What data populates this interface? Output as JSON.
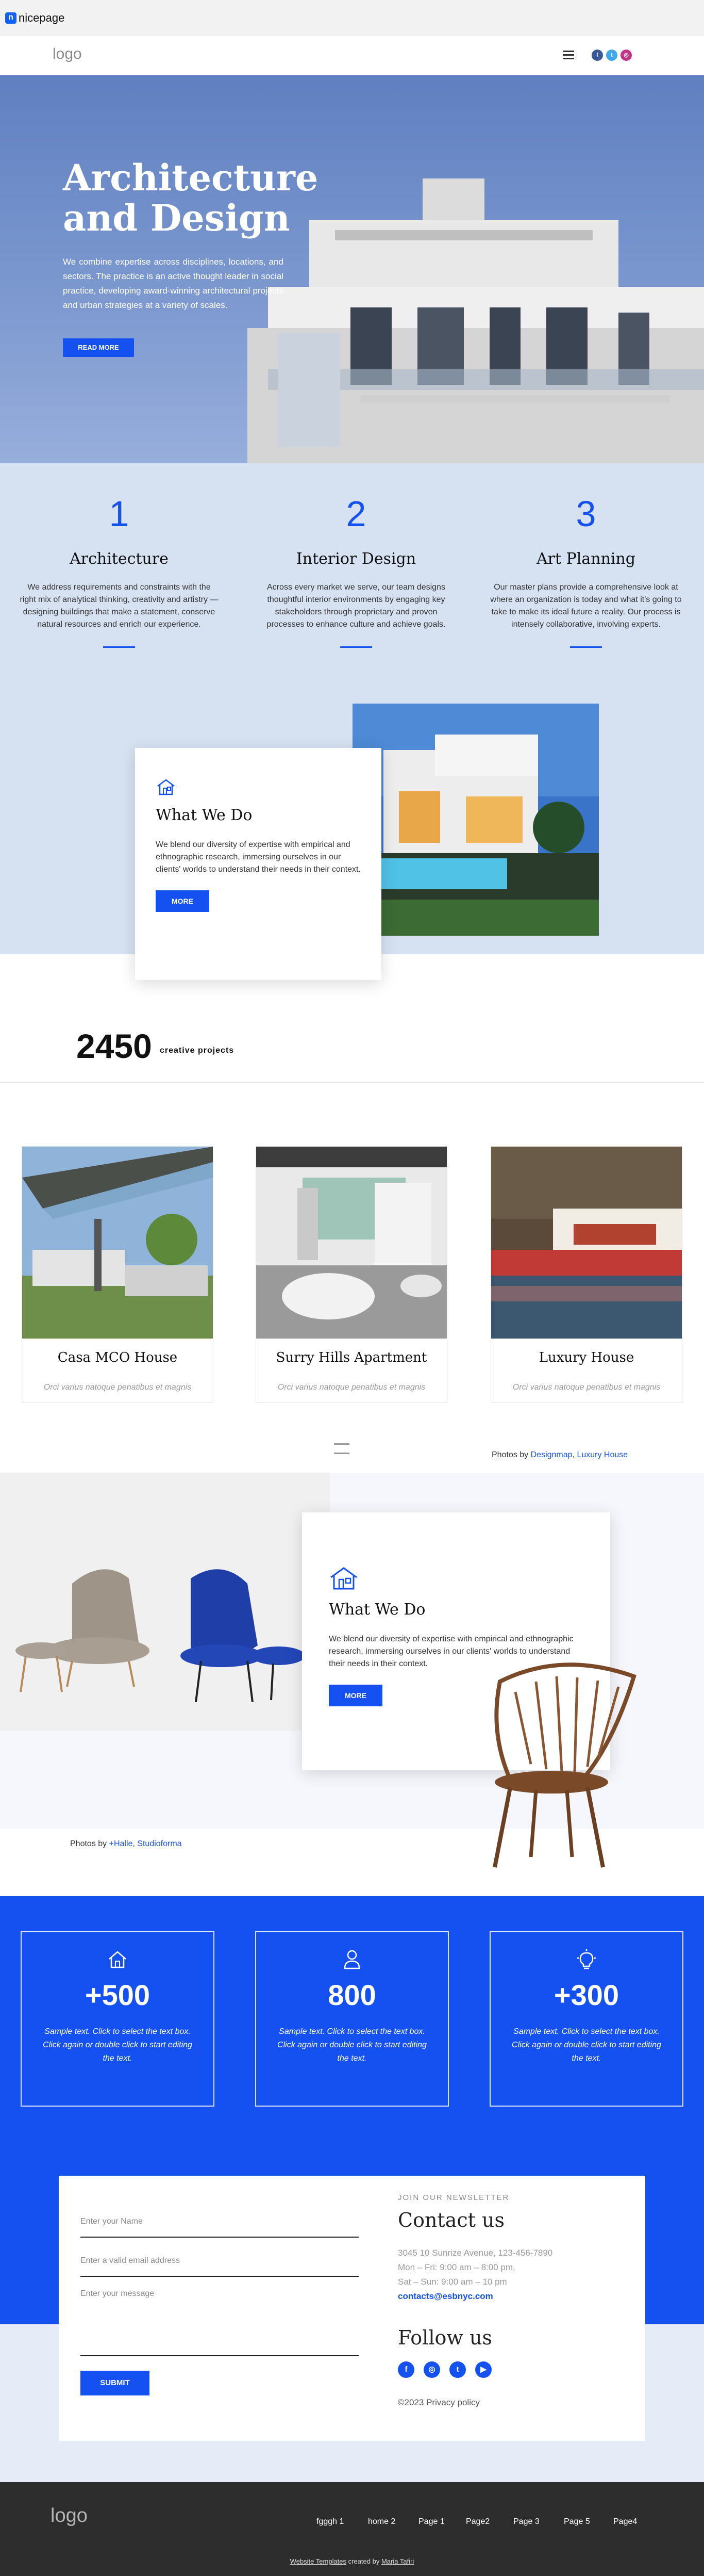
{
  "topbar": {
    "brand_mark": "n",
    "brand_name": "nicepage"
  },
  "header": {
    "logo": "logo",
    "social": [
      {
        "name": "facebook",
        "color": "#3b5998",
        "glyph": "f"
      },
      {
        "name": "twitter",
        "color": "#3ea8e8",
        "glyph": "t"
      },
      {
        "name": "instagram",
        "color": "#c13584",
        "glyph": "◎"
      }
    ]
  },
  "hero": {
    "title": "Architecture and Design",
    "text": "We combine expertise across disciplines, locations, and sectors. The practice is an active thought leader in social practice, developing award-winning architectural projects and urban strategies at a variety of scales.",
    "button": "READ MORE"
  },
  "features": [
    {
      "number": "1",
      "title": "Architecture",
      "text": "We address requirements and constraints with the right mix of analytical thinking, creativity and artistry — designing buildings that make a statement, conserve natural resources and enrich our experience."
    },
    {
      "number": "2",
      "title": "Interior Design",
      "text": "Across every market we serve, our team designs thoughtful interior environments by engaging key stakeholders through proprietary and proven processes to enhance culture and achieve goals."
    },
    {
      "number": "3",
      "title": "Art Planning",
      "text": "Our master plans provide a comprehensive look at where an organization is today and what it's going to take to make its ideal future a reality. Our process is intensely collaborative, involving experts."
    }
  ],
  "what_we_do_1": {
    "title": "What We Do",
    "text": "We blend our diversity of expertise with empirical and ethnographic research, immersing ourselves in our clients' worlds to understand their needs in their context.",
    "button": "MORE"
  },
  "counter": {
    "number": "2450",
    "label": "creative projects"
  },
  "projects": [
    {
      "title": "Casa MCO House",
      "text": "Orci varius natoque penatibus et magnis"
    },
    {
      "title": "Surry Hills Apartment",
      "text": "Orci varius natoque penatibus et magnis"
    },
    {
      "title": "Luxury House",
      "text": "Orci varius natoque penatibus et magnis"
    }
  ],
  "photos_credit_1": {
    "prefix": "Photos by ",
    "link1": "Designmap",
    "sep": ", ",
    "link2": "Luxury House"
  },
  "what_we_do_2": {
    "title": "What We Do",
    "text": "We blend our diversity of expertise with empirical and ethnographic research, immersing ourselves in our clients' worlds to understand their needs in their context.",
    "button": "MORE"
  },
  "photos_credit_2": {
    "prefix": "Photos by ",
    "link1": "+Halle",
    "sep": ", ",
    "link2": "Studioforma"
  },
  "stats": [
    {
      "icon": "house-icon",
      "number": "+500",
      "text": "Sample text. Click to select the text box. Click again or double click to start editing the text."
    },
    {
      "icon": "person-icon",
      "number": "800",
      "text": "Sample text. Click to select the text box. Click again or double click to start editing the text."
    },
    {
      "icon": "bulb-icon",
      "number": "+300",
      "text": "Sample text. Click to select the text box. Click again or double click to start editing the text."
    }
  ],
  "form": {
    "name_placeholder": "Enter your Name",
    "email_placeholder": "Enter a valid email address",
    "message_placeholder": "Enter your message",
    "submit": "SUBMIT"
  },
  "contact": {
    "newsletter_label": "JOIN OUR NEWSLETTER",
    "title": "Contact us",
    "address": "3045 10 Sunrize Avenue, 123-456-7890",
    "hours1": "Mon – Fri: 9:00 am – 8:00 pm,",
    "hours2": "Sat – Sun: 9:00 am – 10 pm",
    "email": "contacts@esbnyc.com",
    "follow_title": "Follow us",
    "follow_icons": [
      "f",
      "◎",
      "t",
      "▶"
    ],
    "copyright": "©2023 Privacy policy"
  },
  "footer": {
    "logo": "logo",
    "nav": [
      "fgggh 1",
      "home 2",
      "Page 1",
      "Page2",
      "Page 3",
      "Page 5",
      "Page4"
    ],
    "credit_link1": "Website Templates",
    "credit_mid": " created by ",
    "credit_link2": "Maria Tafiri"
  },
  "colors": {
    "accent": "#1451f0",
    "hero": "#6f8dcc",
    "features_bg": "#d6e2f2",
    "footer_bg": "#2d2d2d"
  }
}
